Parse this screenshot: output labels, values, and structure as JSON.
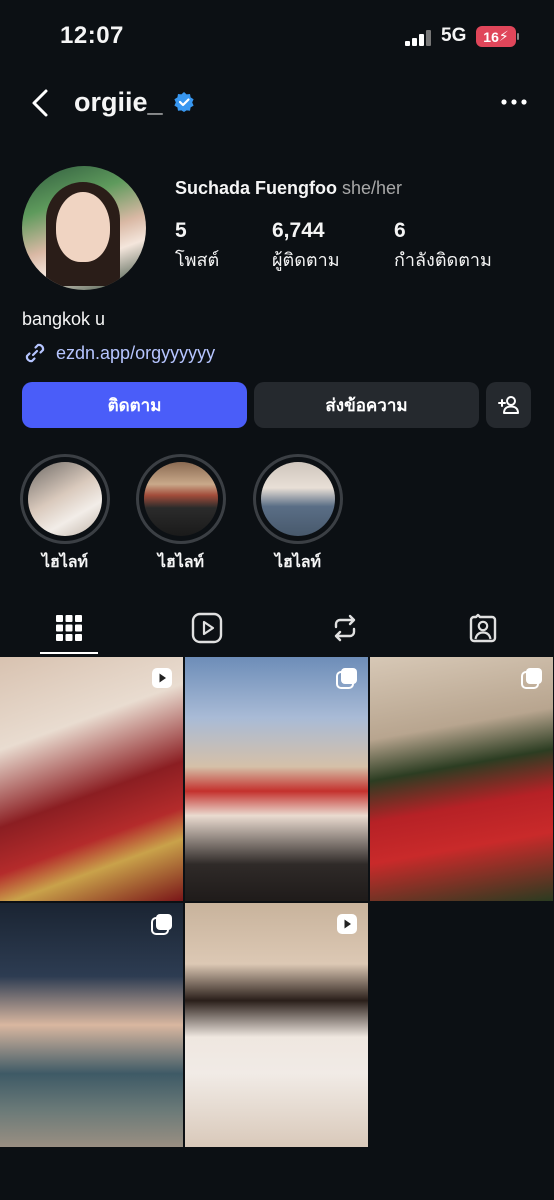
{
  "status_bar": {
    "time": "12:07",
    "network": "5G",
    "battery": "16"
  },
  "profile": {
    "username": "orgiie_",
    "full_name": "Suchada Fuengfoo",
    "pronouns": "she/her",
    "stats": [
      {
        "value": "5",
        "label": "โพสต์"
      },
      {
        "value": "6,744",
        "label": "ผู้ติดตาม"
      },
      {
        "value": "6",
        "label": "กำลังติดตาม"
      }
    ],
    "bio": "bangkok u",
    "link": "ezdn.app/orgyyyyyy"
  },
  "actions": {
    "follow": "ติดตาม",
    "message": "ส่งข้อความ"
  },
  "highlights": [
    {
      "label": "ไฮไลท์"
    },
    {
      "label": "ไฮไลท์"
    },
    {
      "label": "ไฮไลท์"
    }
  ],
  "tabs": [
    "posts-grid",
    "reels",
    "reposts",
    "tagged"
  ],
  "posts": [
    {
      "type": "reel"
    },
    {
      "type": "carousel"
    },
    {
      "type": "carousel"
    },
    {
      "type": "carousel"
    },
    {
      "type": "reel"
    }
  ],
  "colors": {
    "background": "#0c1014",
    "accent": "#4a5df9",
    "link": "#b6c5ff",
    "verified": "#3897f0",
    "battery": "#e0465a"
  }
}
